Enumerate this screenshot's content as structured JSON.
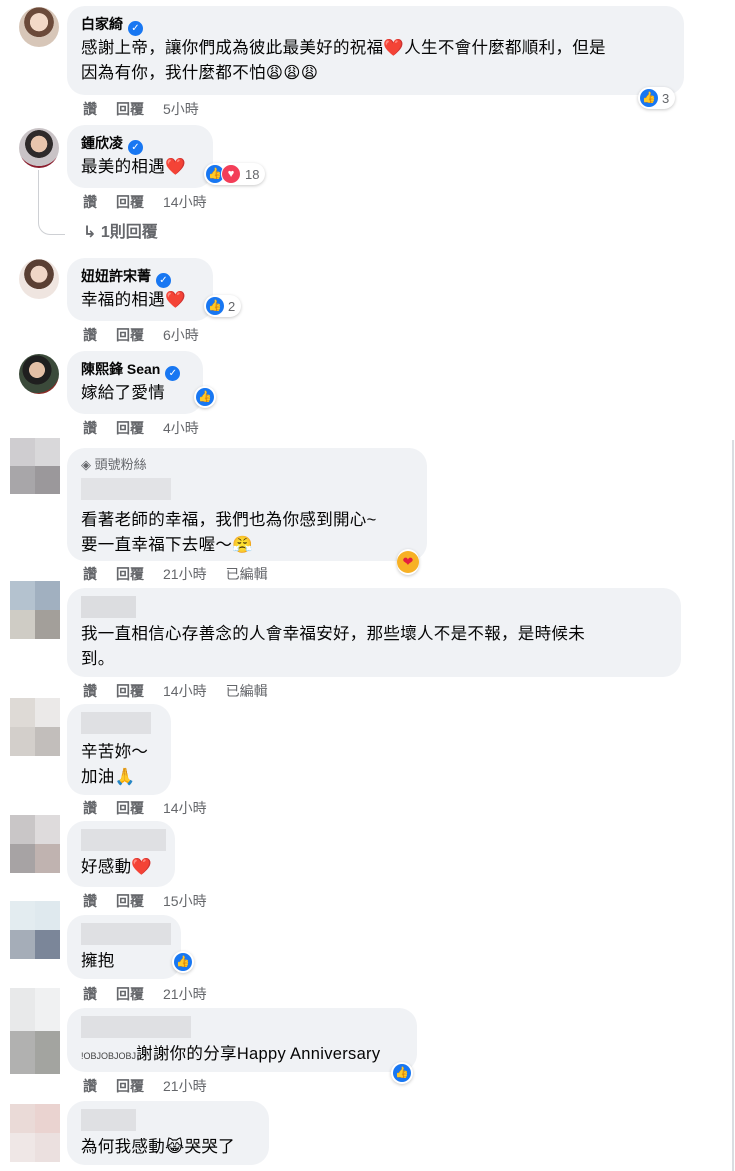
{
  "comments": [
    {
      "name": "白家綺",
      "verified": true,
      "text_lines": [
        "感謝上帝，讓你們成為彼此最美好的祝福❤️人生不會什麼都順利，但是",
        "因為有你，我什麼都不怕😩😩😩"
      ],
      "reactions": {
        "icons": [
          "like"
        ],
        "count": "3"
      },
      "actions": {
        "like": "讚",
        "reply": "回覆",
        "time": "5小時",
        "edited": ""
      }
    },
    {
      "name": "鍾欣凌",
      "verified": true,
      "text_lines": [
        "最美的相遇❤️"
      ],
      "reactions": {
        "icons": [
          "like",
          "love"
        ],
        "count": "18"
      },
      "actions": {
        "like": "讚",
        "reply": "回覆",
        "time": "14小時",
        "edited": ""
      },
      "replies_link": "1則回覆"
    },
    {
      "name": "妞妞許宋菁",
      "verified": true,
      "text_lines": [
        "幸福的相遇❤️"
      ],
      "reactions": {
        "icons": [
          "like"
        ],
        "count": "2"
      },
      "actions": {
        "like": "讚",
        "reply": "回覆",
        "time": "6小時",
        "edited": ""
      }
    },
    {
      "name": "陳熙鋒 Sean",
      "verified": true,
      "text_lines": [
        "嫁給了愛情"
      ],
      "reactions": {
        "icons": [
          "like"
        ],
        "count": ""
      },
      "actions": {
        "like": "讚",
        "reply": "回覆",
        "time": "4小時",
        "edited": ""
      }
    },
    {
      "name": "",
      "badge": "頭號粉絲",
      "text_lines": [
        "看著老師的幸福，我們也為你感到開心~",
        "要一直幸福下去喔～😤"
      ],
      "reactions": {
        "icons": [
          "care"
        ],
        "count": ""
      },
      "actions": {
        "like": "讚",
        "reply": "回覆",
        "time": "21小時",
        "edited": "已編輯"
      }
    },
    {
      "name": "",
      "text_lines": [
        "我一直相信心存善念的人會幸福安好，那些壞人不是不報，是時候未",
        "到。"
      ],
      "reactions": {
        "icons": [],
        "count": ""
      },
      "actions": {
        "like": "讚",
        "reply": "回覆",
        "time": "14小時",
        "edited": "已編輯"
      }
    },
    {
      "name": "",
      "text_lines": [
        "辛苦妳～",
        "加油🙏"
      ],
      "reactions": {
        "icons": [],
        "count": ""
      },
      "actions": {
        "like": "讚",
        "reply": "回覆",
        "time": "14小時",
        "edited": ""
      }
    },
    {
      "name": "",
      "text_lines": [
        "好感動❤️"
      ],
      "reactions": {
        "icons": [],
        "count": ""
      },
      "actions": {
        "like": "讚",
        "reply": "回覆",
        "time": "15小時",
        "edited": ""
      }
    },
    {
      "name": "",
      "text_lines": [
        "擁抱"
      ],
      "reactions": {
        "icons": [
          "like"
        ],
        "count": ""
      },
      "actions": {
        "like": "讚",
        "reply": "回覆",
        "time": "21小時",
        "edited": ""
      }
    },
    {
      "name": "",
      "text_lines": [
        "謝謝你的分享Happy Anniversary"
      ],
      "reactions": {
        "icons": [
          "like"
        ],
        "count": ""
      },
      "actions": {
        "like": "讚",
        "reply": "回覆",
        "time": "21小時",
        "edited": ""
      }
    },
    {
      "name": "",
      "text_lines": [
        "為何我感動😹哭哭了"
      ],
      "reactions": {
        "icons": [],
        "count": ""
      },
      "actions": {
        "like": "讚",
        "reply": "回覆",
        "time": "",
        "edited": ""
      }
    }
  ],
  "colors": {
    "like": "#1877f2",
    "love": "#f33e58",
    "bubble": "#f0f2f5",
    "meta": "#65676b"
  }
}
